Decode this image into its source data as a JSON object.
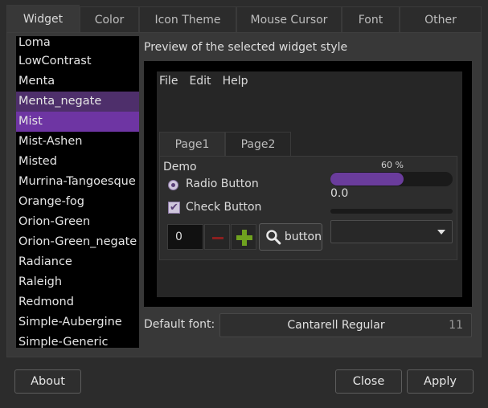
{
  "tabs": [
    {
      "label": "Widget"
    },
    {
      "label": "Color"
    },
    {
      "label": "Icon Theme"
    },
    {
      "label": "Mouse Cursor"
    },
    {
      "label": "Font"
    },
    {
      "label": "Other"
    }
  ],
  "active_tab": "Widget",
  "theme_list": {
    "items": [
      "Loma",
      "LowContrast",
      "Menta",
      "Menta_negate",
      "Mist",
      "Mist-Ashen",
      "Misted",
      "Murrina-Tangoesque",
      "Orange-fog",
      "Orion-Green",
      "Orion-Green_negate",
      "Radiance",
      "Raleigh",
      "Redmond",
      "Simple-Aubergine",
      "Simple-Generic"
    ],
    "hover_item": "Menta_negate",
    "selected_item": "Mist",
    "colors": {
      "hover": "#4e2f6b",
      "selected": "#6e35a3"
    }
  },
  "preview": {
    "title": "Preview of the selected widget style",
    "menu": [
      "File",
      "Edit",
      "Help"
    ],
    "notebook_tabs": [
      "Page1",
      "Page2"
    ],
    "demo_label": "Demo",
    "radio_label": "Radio Button",
    "check_label": "Check Button",
    "check_mark": "✔",
    "spin_value": "0",
    "button_label": "button",
    "progress_label": "60 %",
    "progress_fraction": 0.6,
    "scale_value": "0.0",
    "accent_color": "#6a3c9c"
  },
  "font": {
    "label": "Default font:",
    "name": "Cantarell Regular",
    "size": "11"
  },
  "buttons": {
    "about": "About",
    "close": "Close",
    "apply": "Apply"
  }
}
